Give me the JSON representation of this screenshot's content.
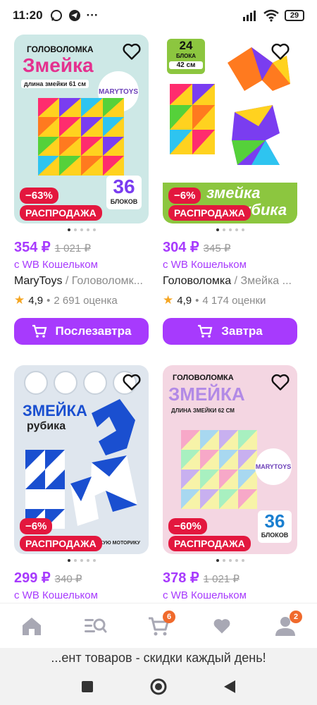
{
  "status": {
    "time": "11:20",
    "battery": "29"
  },
  "products": [
    {
      "discount": "−63%",
      "sale_label": "РАСПРОДАЖА",
      "price": "354 ₽",
      "old_price": "1 021 ₽",
      "wallet": "с WB Кошельком",
      "brand": "MaryToys",
      "name": "Головоломк...",
      "rating": "4,9",
      "reviews": "2 691 оценка",
      "delivery": "Послезавтра",
      "image": {
        "heading": "Головоломка",
        "title": "Змейка",
        "subtitle": "длина змейки 61 см",
        "logo": "MARYTOYS",
        "count": "36",
        "count_label": "блоков"
      }
    },
    {
      "discount": "−6%",
      "sale_label": "РАСПРОДАЖА",
      "price": "304 ₽",
      "old_price": "345 ₽",
      "wallet": "с WB Кошельком",
      "brand": "Головоломка",
      "name": "Змейка ...",
      "rating": "4,9",
      "reviews": "4 174 оценки",
      "delivery": "Завтра",
      "image": {
        "blocks": "24",
        "blocks_label": "блока",
        "length": "42 см",
        "title": "змейка",
        "subtitle": "рубика"
      }
    },
    {
      "discount": "−6%",
      "sale_label": "РАСПРОДАЖА",
      "price": "299 ₽",
      "old_price": "340 ₽",
      "wallet": "с WB Кошельком",
      "image": {
        "title": "ЗМЕЙКА",
        "subtitle": "рубика",
        "note": "мелкую моторику"
      }
    },
    {
      "discount": "−60%",
      "sale_label": "РАСПРОДАЖА",
      "price": "378 ₽",
      "old_price": "1 021 ₽",
      "wallet": "с WB Кошельком",
      "image": {
        "heading": "Головоломка",
        "title": "ЗМЕЙКА",
        "subtitle": "длина змейки 62 см",
        "logo": "MARYTOYS",
        "count": "36",
        "count_label": "блоков"
      }
    }
  ],
  "tabbar": {
    "cart_badge": "6",
    "profile_badge": "2"
  },
  "banner": "...ент товаров - скидки каждый день!",
  "colors": {
    "accent": "#a73afd",
    "sale": "#e3173e",
    "badge": "#f06a2c"
  }
}
